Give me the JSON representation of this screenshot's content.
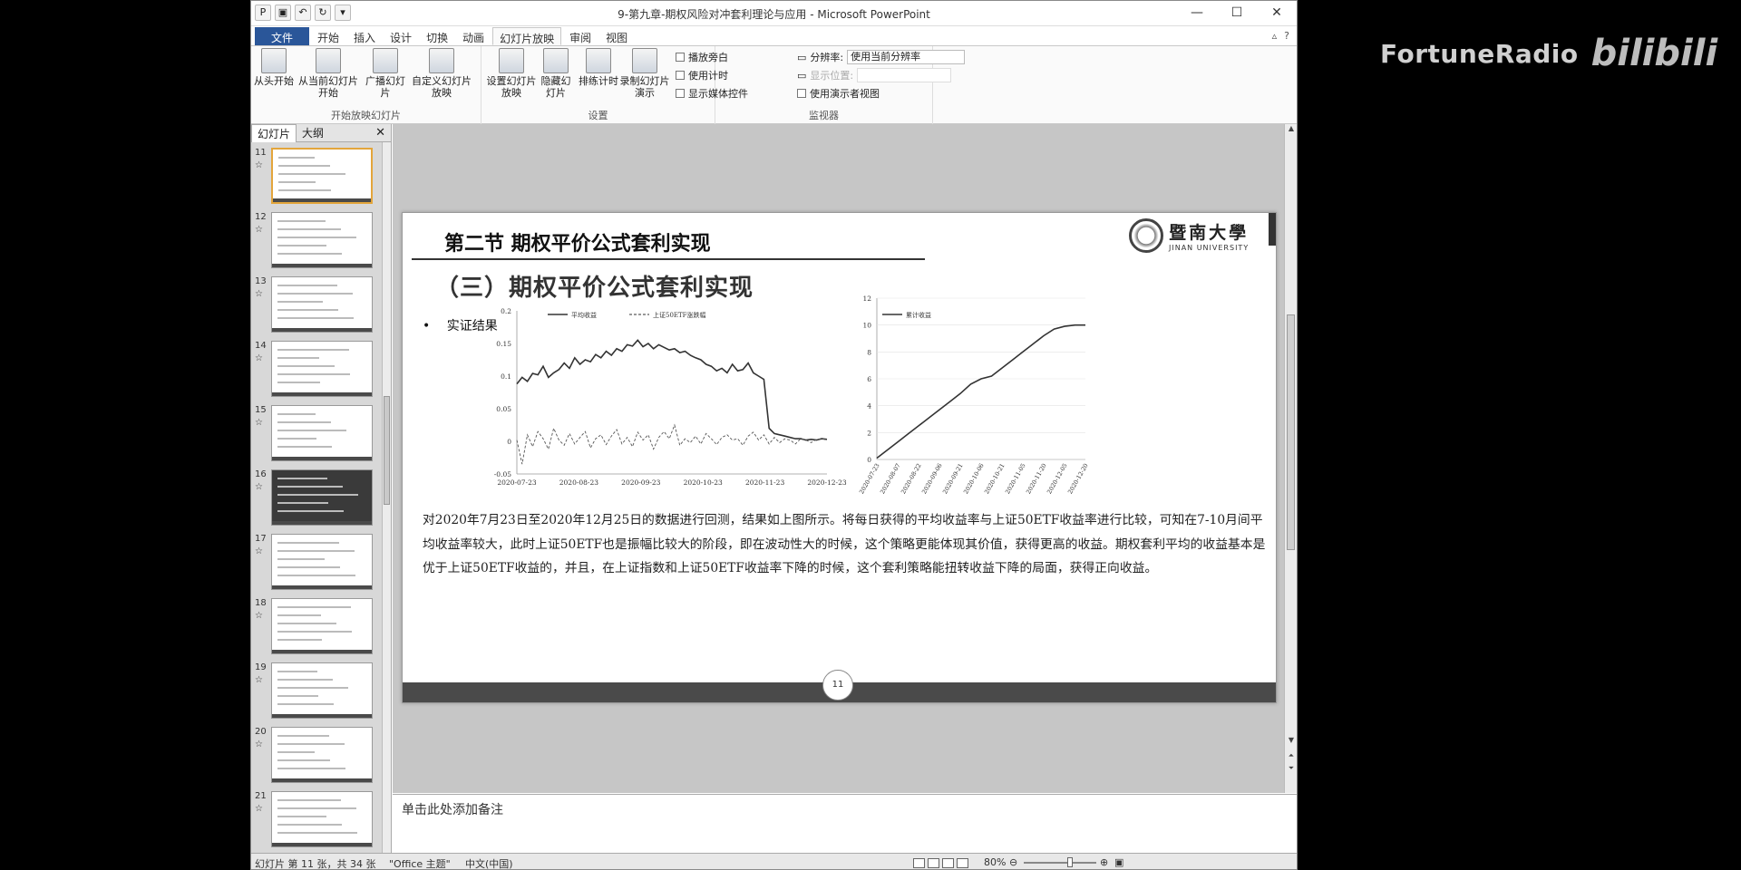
{
  "window": {
    "title": "9-第九章-期权风险对冲套利理论与应用 - Microsoft PowerPoint",
    "controls": [
      "—",
      "☐",
      "✕"
    ]
  },
  "ribbon": {
    "tabs": [
      "文件",
      "开始",
      "插入",
      "设计",
      "切换",
      "动画",
      "幻灯片放映",
      "审阅",
      "视图"
    ],
    "active_tab": "幻灯片放映",
    "groups": {
      "start": {
        "label": "开始放映幻灯片",
        "from_start": "从头开始",
        "from_current": "从当前幻灯片开始",
        "broadcast": "广播幻灯片",
        "custom": "自定义幻灯片放映"
      },
      "setup": {
        "label": "设置",
        "setup_show": "设置幻灯片放映",
        "hide_slide": "隐藏幻灯片",
        "rehearse": "排练计时",
        "record": "录制幻灯片演示",
        "play_narrations": "播放旁白",
        "use_timings": "使用计时",
        "show_media_controls": "显示媒体控件"
      },
      "monitors": {
        "label": "监视器",
        "resolution_label": "分辨率:",
        "resolution_value": "使用当前分辨率",
        "show_on_label": "显示位置:",
        "presenter_view": "使用演示者视图"
      }
    }
  },
  "left_pane": {
    "tabs": [
      "幻灯片",
      "大纲"
    ],
    "close": "✕",
    "thumbnails": [
      {
        "num": "11"
      },
      {
        "num": "12"
      },
      {
        "num": "13"
      },
      {
        "num": "14"
      },
      {
        "num": "15"
      },
      {
        "num": "16"
      },
      {
        "num": "17"
      },
      {
        "num": "18"
      },
      {
        "num": "19"
      },
      {
        "num": "20"
      },
      {
        "num": "21"
      }
    ]
  },
  "slide": {
    "section_title": "第二节 期权平价公式套利实现",
    "subtitle": "（三）期权平价公式套利实现",
    "bullet_mark": "•",
    "bullet": "实证结果",
    "logo_cn": "暨南大學",
    "logo_en": "JINAN UNIVERSITY",
    "paragraph": "对2020年7月23日至2020年12月25日的数据进行回测，结果如上图所示。将每日获得的平均收益率与上证50ETF收益率进行比较，可知在7-10月间平均收益率较大，此时上证50ETF也是振幅比较大的阶段，即在波动性大的时候，这个策略更能体现其价值，获得更高的收益。期权套利平均的收益基本是优于上证50ETF收益的，并且，在上证指数和上证50ETF收益率下降的时候，这个套利策略能扭转收益下降的局面，获得正向收益。",
    "page_number": "11"
  },
  "chart_data": [
    {
      "type": "line",
      "legend": [
        "平均收益",
        "上证50ETF涨跌幅"
      ],
      "legend_position": "top-left",
      "x_ticks": [
        "2020-07-23",
        "2020-08-23",
        "2020-09-23",
        "2020-10-23",
        "2020-11-23",
        "2020-12-23"
      ],
      "y_ticks": [
        "-0.05",
        "0",
        "0.05",
        "0.1",
        "0.15",
        "0.2"
      ],
      "ylim": [
        -0.05,
        0.2
      ],
      "grid": false,
      "series": [
        {
          "name": "平均收益",
          "style": "solid",
          "values": [
            0.088,
            0.098,
            0.092,
            0.104,
            0.102,
            0.115,
            0.098,
            0.105,
            0.11,
            0.12,
            0.112,
            0.128,
            0.118,
            0.125,
            0.122,
            0.133,
            0.128,
            0.138,
            0.132,
            0.142,
            0.138,
            0.148,
            0.146,
            0.155,
            0.145,
            0.15,
            0.142,
            0.148,
            0.144,
            0.14,
            0.142,
            0.136,
            0.138,
            0.132,
            0.128,
            0.125,
            0.118,
            0.115,
            0.108,
            0.112,
            0.105,
            0.118,
            0.108,
            0.11,
            0.12,
            0.105,
            0.1,
            0.095,
            0.02,
            0.012,
            0.01,
            0.008,
            0.006,
            0.004,
            0.004,
            0.002,
            0.003,
            0.002,
            0.004,
            0.003
          ]
        },
        {
          "name": "上证50ETF涨跌幅",
          "style": "dashed",
          "values": [
            0.002,
            -0.035,
            0.01,
            -0.008,
            0.015,
            0.004,
            -0.012,
            0.02,
            0.002,
            -0.006,
            0.012,
            -0.004,
            0.006,
            0.015,
            -0.01,
            0.004,
            0.01,
            -0.005,
            0.008,
            0.018,
            -0.004,
            0.006,
            -0.008,
            0.014,
            0.002,
            0.01,
            -0.012,
            0.006,
            0.015,
            0.004,
            0.025,
            -0.006,
            0.004,
            -0.002,
            0.008,
            -0.004,
            0.012,
            0.004,
            -0.005,
            0.006,
            0.01,
            0.002,
            0.004,
            -0.006,
            0.008,
            0.014,
            0.002,
            0.01,
            -0.004,
            0.006,
            -0.002,
            0.004,
            0.002,
            -0.004,
            0.004,
            0.002,
            -0.002,
            0.003,
            0.004,
            0.002
          ]
        }
      ]
    },
    {
      "type": "line",
      "legend": [
        "累计收益"
      ],
      "legend_position": "top-left",
      "x_ticks": [
        "2020-07-23",
        "2020-08-07",
        "2020-08-22",
        "2020-09-06",
        "2020-09-21",
        "2020-10-06",
        "2020-10-21",
        "2020-11-05",
        "2020-11-20",
        "2020-12-05",
        "2020-12-20"
      ],
      "y_ticks": [
        "0",
        "2",
        "4",
        "6",
        "8",
        "10",
        "12"
      ],
      "ylim": [
        0,
        12
      ],
      "grid": true,
      "series": [
        {
          "name": "累计收益",
          "style": "solid",
          "values": [
            0.1,
            0.7,
            1.3,
            1.9,
            2.5,
            3.1,
            3.7,
            4.3,
            4.9,
            5.6,
            6.0,
            6.2,
            6.8,
            7.4,
            8.0,
            8.6,
            9.2,
            9.7,
            9.9,
            10.0,
            10.0
          ]
        }
      ]
    }
  ],
  "notes": {
    "placeholder": "单击此处添加备注"
  },
  "statusbar": {
    "slide_info": "幻灯片 第 11 张，共 34 张",
    "theme": "\"Office 主题\"",
    "language": "中文(中国)",
    "zoom": "80%"
  },
  "watermark": {
    "text": "FortuneRadio",
    "logo": "bilibili"
  },
  "colors": {
    "file_tab": "#2a5699",
    "current_thumb_border": "#e3a53b",
    "slide_bar": "#4a4a4a"
  }
}
